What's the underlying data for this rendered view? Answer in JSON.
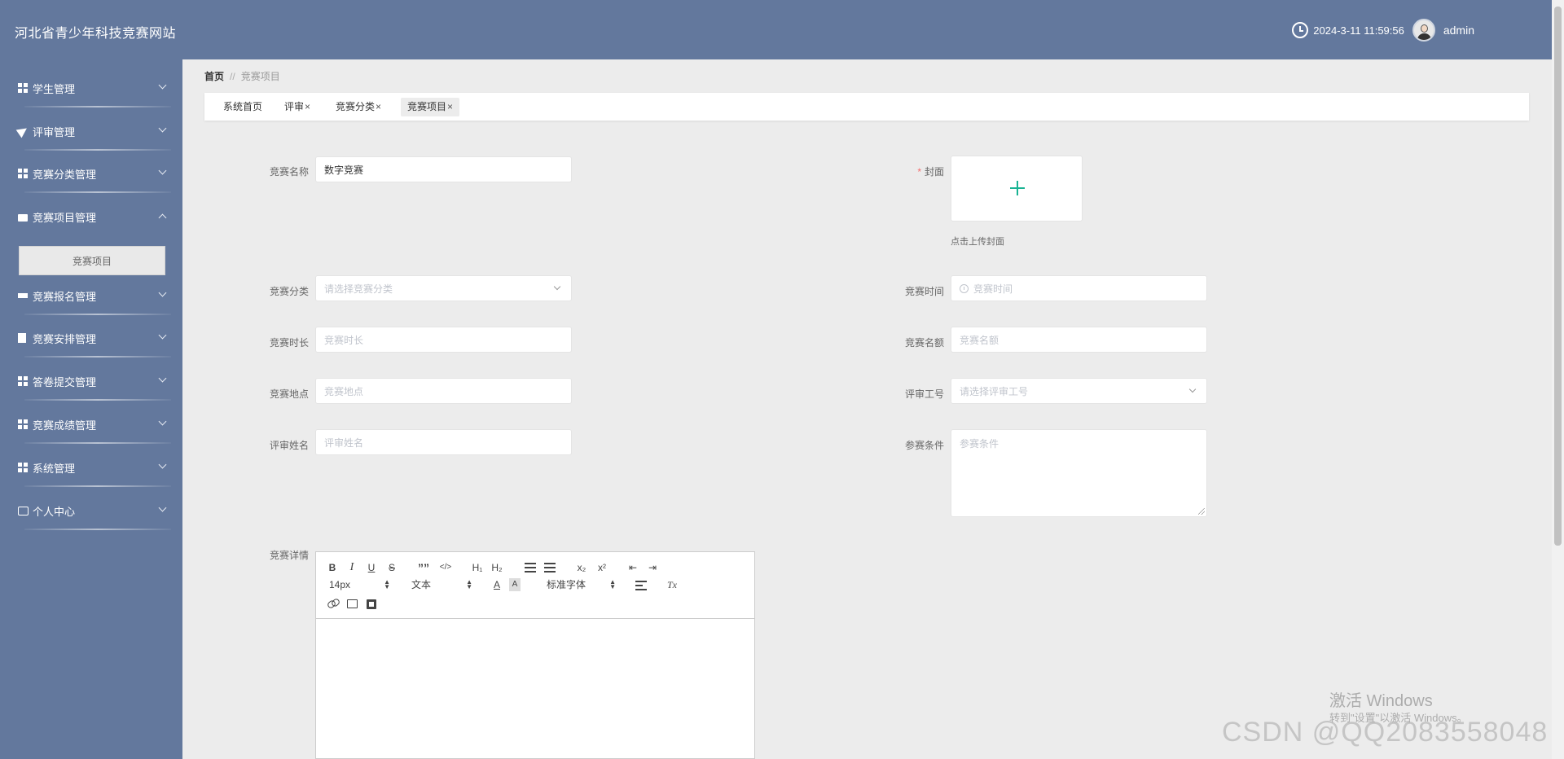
{
  "header": {
    "site_title": "河北省青少年科技竞赛网站",
    "datetime": "2024-3-11 11:59:56",
    "username": "admin"
  },
  "sidebar": {
    "items": [
      {
        "label": "学生管理",
        "icon": "grid-icon",
        "expanded": false
      },
      {
        "label": "评审管理",
        "icon": "paper-plane-icon",
        "expanded": false
      },
      {
        "label": "竞赛分类管理",
        "icon": "grid-icon",
        "expanded": false
      },
      {
        "label": "竞赛项目管理",
        "icon": "briefcase-icon",
        "expanded": true
      },
      {
        "label": "竞赛报名管理",
        "icon": "stand-icon",
        "expanded": false
      },
      {
        "label": "竞赛安排管理",
        "icon": "clipboard-icon",
        "expanded": false
      },
      {
        "label": "答卷提交管理",
        "icon": "grid-icon",
        "expanded": false
      },
      {
        "label": "竞赛成绩管理",
        "icon": "grid-icon",
        "expanded": false
      },
      {
        "label": "系统管理",
        "icon": "grid-icon",
        "expanded": false
      },
      {
        "label": "个人中心",
        "icon": "card-icon",
        "expanded": false
      }
    ],
    "submenu_active": "竞赛项目"
  },
  "breadcrumb": {
    "home": "首页",
    "separator": "//",
    "current": "竞赛项目"
  },
  "tabs": [
    {
      "label": "系统首页",
      "closable": false,
      "active": false
    },
    {
      "label": "评审",
      "closable": true,
      "active": false
    },
    {
      "label": "竞赛分类",
      "closable": true,
      "active": false
    },
    {
      "label": "竞赛项目",
      "closable": true,
      "active": true
    }
  ],
  "tab_close_glyph": "×",
  "form": {
    "name_label": "竞赛名称",
    "name_value": "数字竞赛",
    "cover_required_mark": "*",
    "cover_label": "封面",
    "cover_hint": "点击上传封面",
    "category_label": "竞赛分类",
    "category_placeholder": "请选择竞赛分类",
    "time_label": "竞赛时间",
    "time_placeholder": "竞赛时间",
    "duration_label": "竞赛时长",
    "duration_placeholder": "竞赛时长",
    "quota_label": "竞赛名额",
    "quota_placeholder": "竞赛名额",
    "location_label": "竞赛地点",
    "location_placeholder": "竞赛地点",
    "reviewer_id_label": "评审工号",
    "reviewer_id_placeholder": "请选择评审工号",
    "reviewer_name_label": "评审姓名",
    "reviewer_name_placeholder": "评审姓名",
    "conditions_label": "参赛条件",
    "conditions_placeholder": "参赛条件",
    "details_label": "竞赛详情"
  },
  "editor": {
    "bold": "B",
    "italic": "I",
    "underline": "U",
    "strike": "S",
    "quote": "””",
    "code": "</>",
    "h1": "H₁",
    "h2": "H₂",
    "ordered_list": "1≡",
    "bullet_list": "•≡",
    "subscript": "x₂",
    "superscript": "x²",
    "outdent": "⇤",
    "indent": "⇥",
    "font_size": "14px",
    "text_style": "文本",
    "font_color": "A",
    "bg_color": "A",
    "font_family": "标准字体",
    "clear_format": "Tx"
  },
  "watermarks": {
    "activate_title": "激活 Windows",
    "activate_sub": "转到\"设置\"以激活 Windows。",
    "csdn": "CSDN @QQ2083558048"
  },
  "colors": {
    "sidebar_bg": "#63789d",
    "accent_plus": "#19b393",
    "required": "#f56c6c"
  }
}
